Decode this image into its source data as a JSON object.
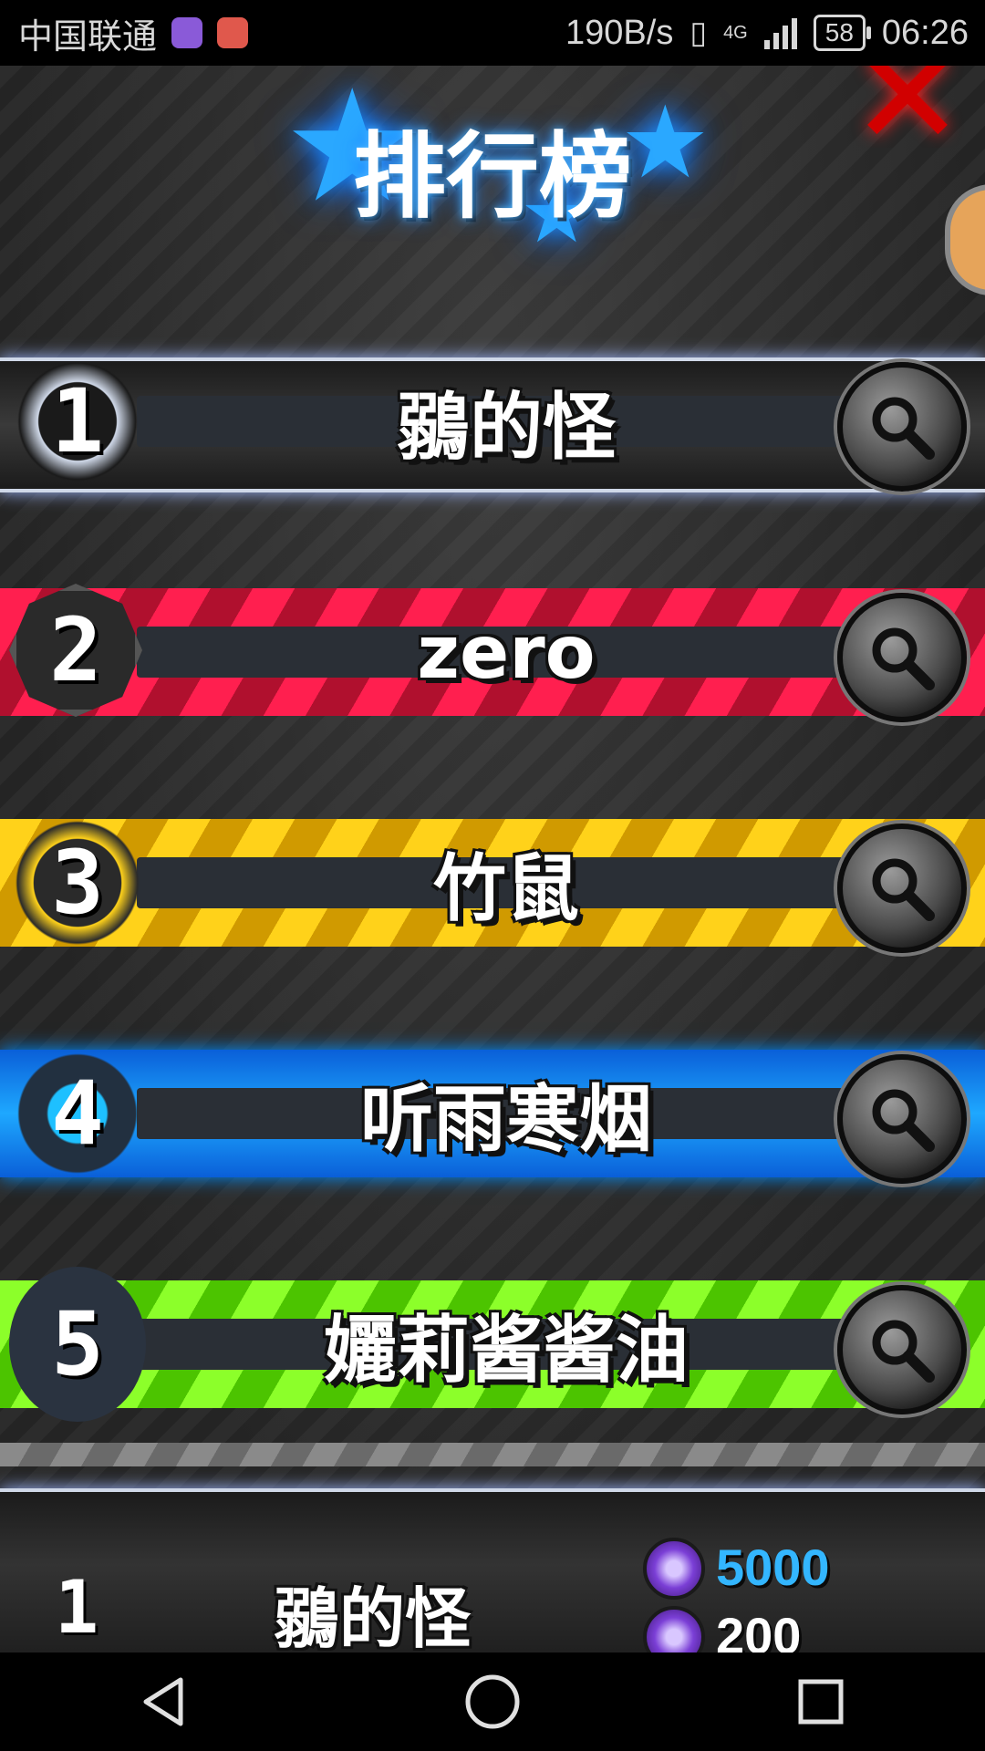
{
  "status_bar": {
    "carrier": "中国联通",
    "net_speed": "190B/s",
    "network_type": "4G",
    "battery": "58",
    "time": "06:26"
  },
  "header": {
    "title": "排行榜"
  },
  "leaderboard": [
    {
      "rank": "1",
      "name": "鶸的怪",
      "theme": "silver"
    },
    {
      "rank": "2",
      "name": "zero",
      "theme": "red"
    },
    {
      "rank": "3",
      "name": "竹鼠",
      "theme": "yellow"
    },
    {
      "rank": "4",
      "name": "听雨寒烟",
      "theme": "blue"
    },
    {
      "rank": "5",
      "name": "孋莉酱酱油",
      "theme": "green"
    }
  ],
  "my_entry": {
    "rank": "1",
    "name": "鶸的怪",
    "score_primary": "5000",
    "score_secondary": "200"
  },
  "icons": {
    "close": "close-x-icon",
    "search": "magnifier-icon",
    "back": "back-triangle-icon",
    "home": "home-circle-icon",
    "recents": "recents-square-icon"
  },
  "colors": {
    "title_glow": "#1a7cff",
    "close_red": "#d10000",
    "score_blue": "#33b6ff"
  }
}
